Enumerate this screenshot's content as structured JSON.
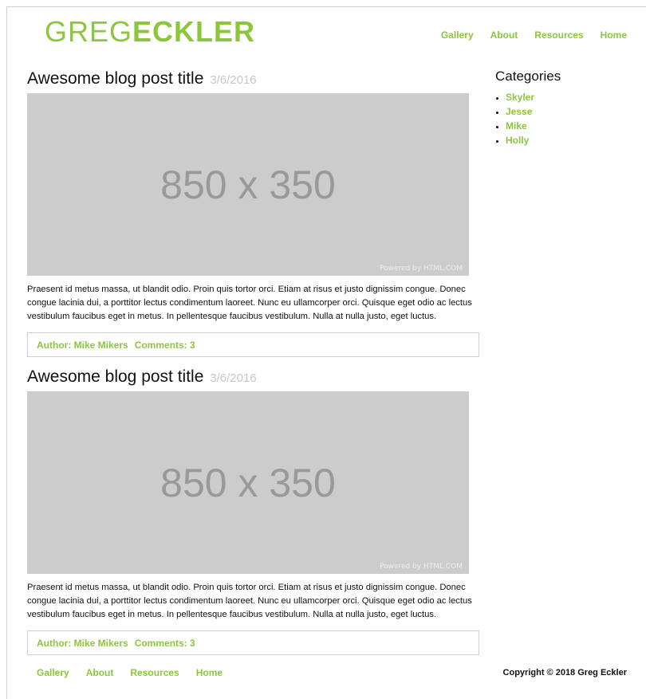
{
  "header": {
    "logo_light": "GREG",
    "logo_bold": "ECKLER",
    "nav": [
      "Gallery",
      "About",
      "Resources",
      "Home"
    ]
  },
  "posts": [
    {
      "title": "Awesome blog post title",
      "date": "3/6/2016",
      "image_text": "850 x 350",
      "image_credit": "Powered by HTML.COM",
      "body": "Praesent id metus massa, ut blandit odio. Proin quis tortor orci. Etiam at risus et justo dignissim congue. Donec congue lacinia dui, a porttitor lectus condimentum laoreet. Nunc eu ullamcorper orci. Quisque eget odio ac lectus vestibulum faucibus eget in metus. In pellentesque faucibus vestibulum. Nulla at nulla justo, eget luctus.",
      "author": "Author: Mike Mikers",
      "comments": "Comments: 3"
    },
    {
      "title": "Awesome blog post title",
      "date": "3/6/2016",
      "image_text": "850 x 350",
      "image_credit": "Powered by HTML.COM",
      "body": "Praesent id metus massa, ut blandit odio. Proin quis tortor orci. Etiam at risus et justo dignissim congue. Donec congue lacinia dui, a porttitor lectus condimentum laoreet. Nunc eu ullamcorper orci. Quisque eget odio ac lectus vestibulum faucibus eget in metus. In pellentesque faucibus vestibulum. Nulla at nulla justo, eget luctus.",
      "author": "Author: Mike Mikers",
      "comments": "Comments: 3"
    }
  ],
  "sidebar": {
    "heading": "Categories",
    "categories": [
      "Skyler",
      "Jesse",
      "Mike",
      "Holly"
    ]
  },
  "footer": {
    "nav": [
      "Gallery",
      "About",
      "Resources",
      "Home"
    ],
    "copyright": "Copyright © 2018 Greg Eckler"
  },
  "colors": {
    "accent": "#8cc63f",
    "placeholder_bg": "#cccccc",
    "placeholder_text": "#999999"
  }
}
